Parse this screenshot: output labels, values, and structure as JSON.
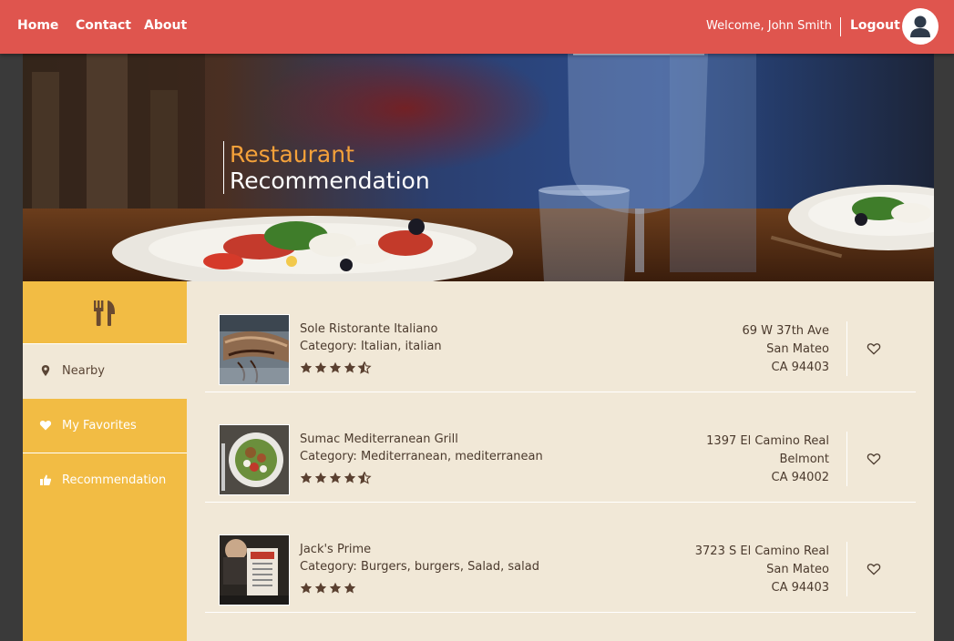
{
  "nav": {
    "home": "Home",
    "contact": "Contact",
    "about": "About",
    "welcome": "Welcome, John Smith",
    "logout": "Logout",
    "avatar_icon": "user-icon"
  },
  "hero": {
    "line1": "Restaurant",
    "line2": "Recommendation"
  },
  "sidebar": {
    "header_icon": "fork-knife-icon",
    "items": [
      {
        "label": "Nearby",
        "icon": "map-marker-icon",
        "active": true
      },
      {
        "label": "My Favorites",
        "icon": "heart-icon",
        "active": false
      },
      {
        "label": "Recommendation",
        "icon": "thumbs-up-icon",
        "active": false
      }
    ]
  },
  "restaurants": [
    {
      "name": "Sole Ristorante Italiano",
      "category": "Category: Italian, italian",
      "rating": 4.5,
      "address": [
        "69 W 37th Ave",
        "San Mateo",
        "CA 94403"
      ],
      "favorite_icon": "heart-outline-icon"
    },
    {
      "name": "Sumac Mediterranean Grill",
      "category": "Category: Mediterranean, mediterranean",
      "rating": 4.5,
      "address": [
        "1397 El Camino Real",
        "Belmont",
        "CA 94002"
      ],
      "favorite_icon": "heart-outline-icon"
    },
    {
      "name": "Jack's Prime",
      "category": "Category: Burgers, burgers, Salad, salad",
      "rating": 4,
      "address": [
        "3723 S El Camino Real",
        "San Mateo",
        "CA 94403"
      ],
      "favorite_icon": "heart-outline-icon"
    }
  ],
  "colors": {
    "nav_bar": "#df554e",
    "hero_accent": "#f4a13a",
    "sidebar": "#f2bc44",
    "content_bg": "#f1e8d7",
    "text": "#4b3a2d",
    "star": "#5a4030"
  }
}
